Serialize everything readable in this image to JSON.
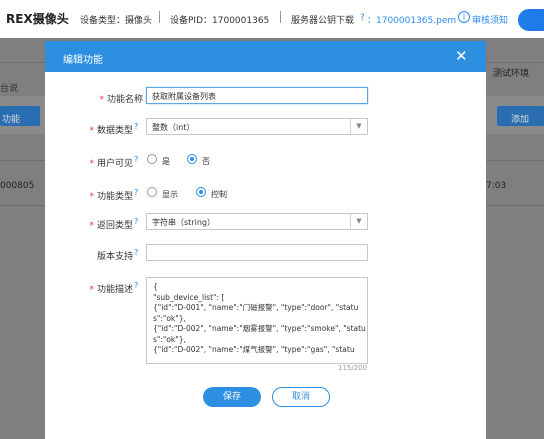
{
  "header": {
    "brand": "REX摄像头",
    "device_type": "设备类型：摄像头",
    "device_pid": "设备PID：1700001365",
    "key_download_label": "服务器公钥下载",
    "key_download_q": "?",
    "key_file": "：1700001365.pem",
    "help_icon": "i",
    "help_label": "审核须知"
  },
  "background": {
    "left_label_1": "台说",
    "left_tab": "功能",
    "right_tag": "测试环境",
    "right_button": "添加",
    "left_value": "000805",
    "right_value": "7:03"
  },
  "modal": {
    "title": "编辑功能",
    "close": "✕",
    "fields": {
      "name": {
        "label": "功能名称",
        "value": "获取附属设备列表"
      },
      "data_type": {
        "label": "数据类型",
        "value": "整数（int）"
      },
      "user_visible": {
        "label": "用户可见",
        "option_yes": "是",
        "option_no": "否",
        "selected": "否"
      },
      "func_type": {
        "label": "功能类型",
        "option_display": "显示",
        "option_control": "控制",
        "selected": "控制"
      },
      "return_type": {
        "label": "返回类型",
        "value": "字符串（string）"
      },
      "version": {
        "label": "版本支持",
        "value": ""
      },
      "desc": {
        "label": "功能描述",
        "lines": [
          "{",
          "\"sub_device_list\": [",
          "{\"id\":\"D-001\", \"name\":\"门磁报警\", \"type\":\"door\",  \"statu",
          "s\":\"ok\"},",
          "{\"id\":\"D-002\", \"name\":\"烟雾报警\", \"type\":\"smoke\", \"statu",
          "s\":\"ok\"},",
          "{\"id\":\"D-002\", \"name\":\"煤气报警\", \"type\":\"gas\",   \"statu"
        ],
        "counter": "115/200"
      }
    },
    "help_q": "?",
    "buttons": {
      "save": "保存",
      "cancel": "取消"
    }
  }
}
